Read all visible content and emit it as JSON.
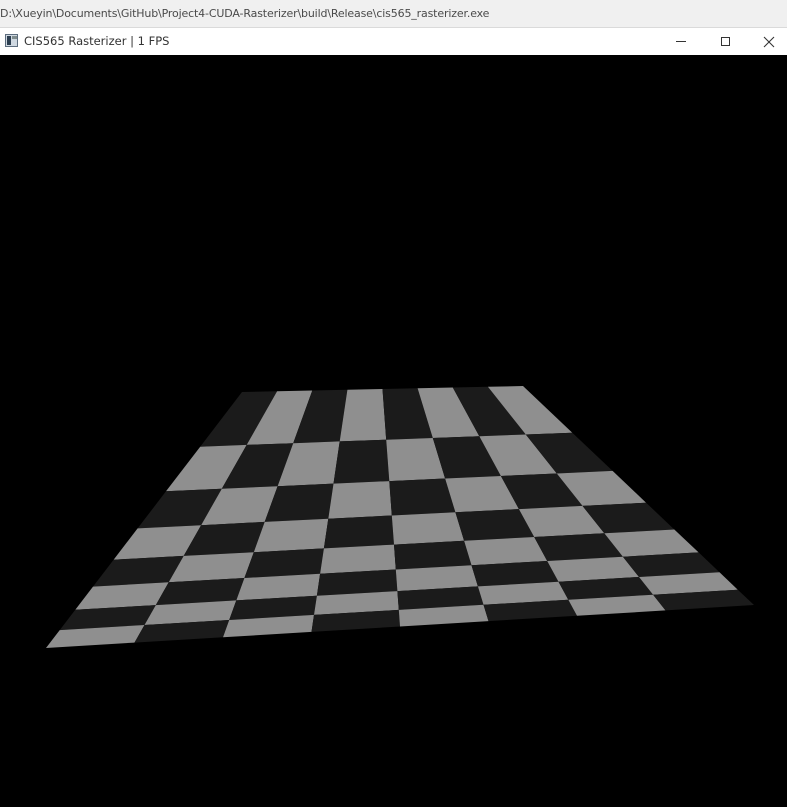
{
  "console": {
    "path": "D:\\Xueyin\\Documents\\GitHub\\Project4-CUDA-Rasterizer\\build\\Release\\cis565_rasterizer.exe"
  },
  "window": {
    "icon": "app-window-icon",
    "title": "CIS565 Rasterizer | 1 FPS",
    "buttons": {
      "minimize_icon": "minimize-icon",
      "maximize_icon": "maximize-icon",
      "close_icon": "close-icon"
    }
  },
  "scene": {
    "background_color": "#000000",
    "plane": {
      "rows": 8,
      "cols": 8,
      "light_color": "#8f8f8f",
      "dark_color": "#1b1b1b"
    }
  }
}
